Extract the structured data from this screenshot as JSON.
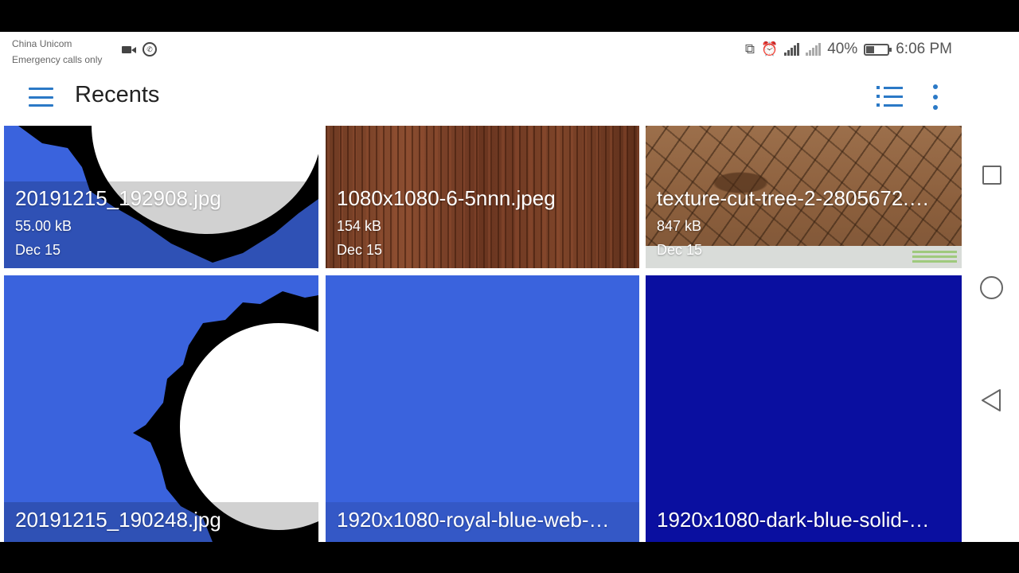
{
  "status_bar": {
    "carrier_name": "China Unicom",
    "carrier_status": "Emergency calls only",
    "battery": "40%",
    "time": "6:06 PM"
  },
  "app_bar": {
    "title": "Recents"
  },
  "files": [
    {
      "name": "20191215_192908.jpg",
      "size": "55.00 kB",
      "date": "Dec 15"
    },
    {
      "name": "1080x1080-6-5nnn.jpeg",
      "size": "154 kB",
      "date": "Dec 15"
    },
    {
      "name": "texture-cut-tree-2-2805672.…",
      "size": "847 kB",
      "date": "Dec 15"
    },
    {
      "name": "20191215_190248.jpg"
    },
    {
      "name": "1920x1080-royal-blue-web-…"
    },
    {
      "name": "1920x1080-dark-blue-solid-…"
    }
  ],
  "colors": {
    "accent": "#2b79c6",
    "royal_blue": "#3a63dd",
    "dark_blue": "#0a0fa0"
  }
}
